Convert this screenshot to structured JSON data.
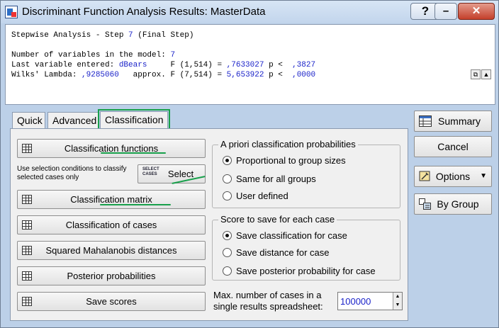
{
  "window": {
    "title": "Discriminant Function Analysis Results: MasterData"
  },
  "titlebar": {
    "help": "?",
    "minimize": "–",
    "close": "✕"
  },
  "output": {
    "line1_prefix": "Stepwise Analysis - Step ",
    "line1_step": "7",
    "line1_suffix": " (Final Step)",
    "line2_prefix": "Number of variables in the model: ",
    "line2_value": "7",
    "line3_prefix": "Last variable entered: ",
    "line3_var": "dBears",
    "line3_mid": "     F (1,514) = ",
    "line3_f": ",7633027",
    "line3_p": " p <  ",
    "line3_pval": ",3827",
    "line4_prefix": "Wilks' Lambda: ",
    "line4_lambda": ",9285060",
    "line4_mid": "   approx. F (7,514) = ",
    "line4_f": "5,653922",
    "line4_p": " p <  ",
    "line4_pval": ",0000"
  },
  "tabs": {
    "quick": "Quick",
    "advanced": "Advanced",
    "classification": "Classification"
  },
  "buttons": {
    "classification_functions": "Classification functions",
    "select": "Select",
    "select_icon_text": "SELECT CASES",
    "classification_matrix": "Classification matrix",
    "classification_of_cases": "Classification of cases",
    "squared_mahalanobis": "Squared Mahalanobis distances",
    "posterior_probabilities": "Posterior probabilities",
    "save_scores": "Save scores"
  },
  "hint": "Use selection conditions to classify selected cases only",
  "apriori": {
    "legend": "A priori classification probabilities",
    "options": [
      "Proportional to group sizes",
      "Same for all groups",
      "User defined"
    ],
    "selected": 0
  },
  "score_save": {
    "legend": "Score to save for each case",
    "options": [
      "Save classification for case",
      "Save distance for case",
      "Save posterior probability for case"
    ],
    "selected": 0
  },
  "max_cases": {
    "label_line1": "Max. number of cases in a",
    "label_line2": "single results spreadsheet:",
    "value": "100000"
  },
  "right_buttons": {
    "summary": "Summary",
    "cancel": "Cancel",
    "options": "Options",
    "by_group": "By Group"
  },
  "colors": {
    "highlight": "#18a04b",
    "value_blue": "#1a22c9"
  }
}
